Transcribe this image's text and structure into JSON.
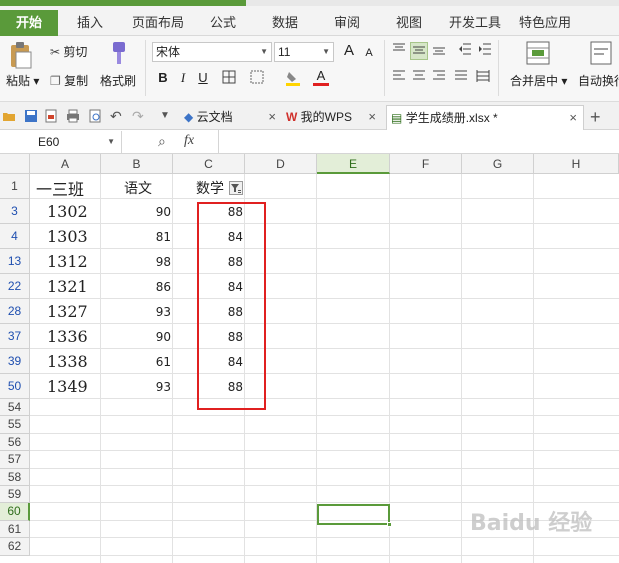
{
  "ribbon_tabs": [
    "开始",
    "插入",
    "页面布局",
    "公式",
    "数据",
    "审阅",
    "视图",
    "开发工具",
    "特色应用"
  ],
  "ribbon": {
    "paste_label": "粘贴",
    "cut_label": "剪切",
    "copy_label": "复制",
    "format_painter_label": "格式刷",
    "font_name": "宋体",
    "font_size": "11",
    "bold": "B",
    "italic": "I",
    "underline": "U",
    "font_color_letter": "A",
    "grow_font": "A",
    "shrink_font": "A",
    "merge_center_label": "合并居中",
    "auto_wrap_label": "自动换行"
  },
  "doc_tabs": [
    {
      "label": "云文档",
      "icon": "cloud-icon"
    },
    {
      "label": "我的WPS",
      "icon": "wps-logo-icon"
    },
    {
      "label": "学生成绩册.xlsx *",
      "icon": "spreadsheet-file-icon",
      "active": true
    }
  ],
  "formula_bar": {
    "cell_ref": "E60",
    "fx": "fx",
    "value": ""
  },
  "columns": [
    "A",
    "B",
    "C",
    "D",
    "E",
    "F",
    "G",
    "H"
  ],
  "selected_column": "E",
  "header_row": {
    "row": "1",
    "A": "一三班",
    "B": "语文",
    "C": "数学"
  },
  "data_rows": [
    {
      "row": "3",
      "A": "1302",
      "B": "90",
      "C": "88"
    },
    {
      "row": "4",
      "A": "1303",
      "B": "81",
      "C": "84"
    },
    {
      "row": "13",
      "A": "1312",
      "B": "98",
      "C": "88"
    },
    {
      "row": "22",
      "A": "1321",
      "B": "86",
      "C": "84"
    },
    {
      "row": "28",
      "A": "1327",
      "B": "93",
      "C": "88"
    },
    {
      "row": "37",
      "A": "1336",
      "B": "90",
      "C": "88"
    },
    {
      "row": "39",
      "A": "1338",
      "B": "61",
      "C": "84"
    },
    {
      "row": "50",
      "A": "1349",
      "B": "93",
      "C": "88"
    }
  ],
  "empty_rows": [
    "54",
    "55",
    "56",
    "57",
    "58",
    "59",
    "60",
    "61",
    "62"
  ],
  "selected_row": "60",
  "colors": {
    "accent_green": "#5a9a3a",
    "highlight_red": "#e02020",
    "filtered_row_number": "#1f4fb0"
  },
  "watermark": "Baidu 经验"
}
